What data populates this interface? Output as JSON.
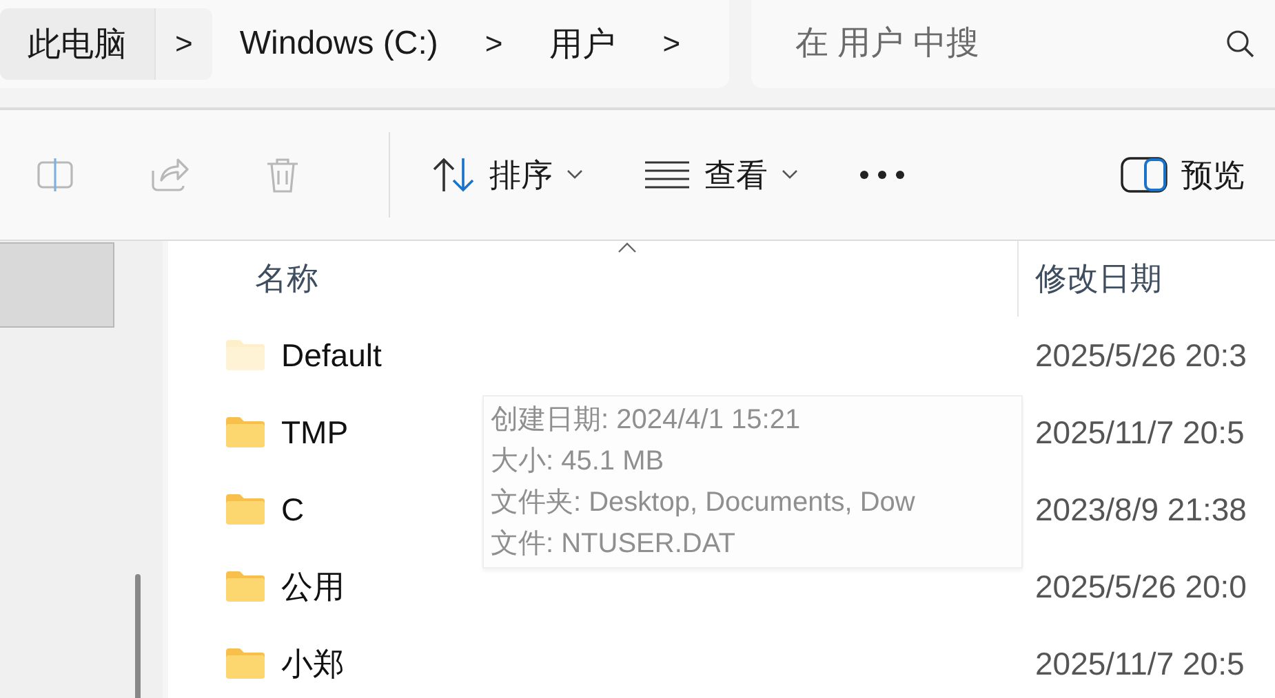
{
  "address_bar": {
    "breadcrumbs": [
      {
        "label": "此电脑",
        "hovered": true
      },
      {
        "label": "Windows (C:)",
        "hovered": false
      },
      {
        "label": "用户",
        "hovered": false
      }
    ],
    "separator": ">"
  },
  "search": {
    "placeholder": "在 用户 中搜"
  },
  "toolbar": {
    "icon_buttons": [
      {
        "kind": "rename",
        "disabled": true
      },
      {
        "kind": "share",
        "disabled": true
      },
      {
        "kind": "delete",
        "disabled": true
      }
    ],
    "sort": {
      "label": "排序"
    },
    "view": {
      "label": "查看"
    },
    "preview": {
      "label": "预览"
    }
  },
  "file_list": {
    "columns": [
      {
        "label": "名称"
      },
      {
        "label": "修改日期"
      }
    ],
    "rows": [
      {
        "name": "Default",
        "hidden": true,
        "modified": "2025/5/26 20:3"
      },
      {
        "name": "TMP",
        "hidden": false,
        "modified": "2025/11/7 20:5"
      },
      {
        "name": "C",
        "hidden": false,
        "modified": "2023/8/9 21:38"
      },
      {
        "name": "公用",
        "hidden": false,
        "modified": "2025/5/26 20:0"
      },
      {
        "name": "小郑",
        "hidden": false,
        "modified": "2025/11/7 20:5"
      }
    ]
  },
  "tooltip": {
    "lines": [
      "创建日期: 2024/4/1 15:21",
      "大小: 45.1 MB",
      "文件夹: Desktop, Documents, Dow",
      "文件: NTUSER.DAT"
    ]
  }
}
